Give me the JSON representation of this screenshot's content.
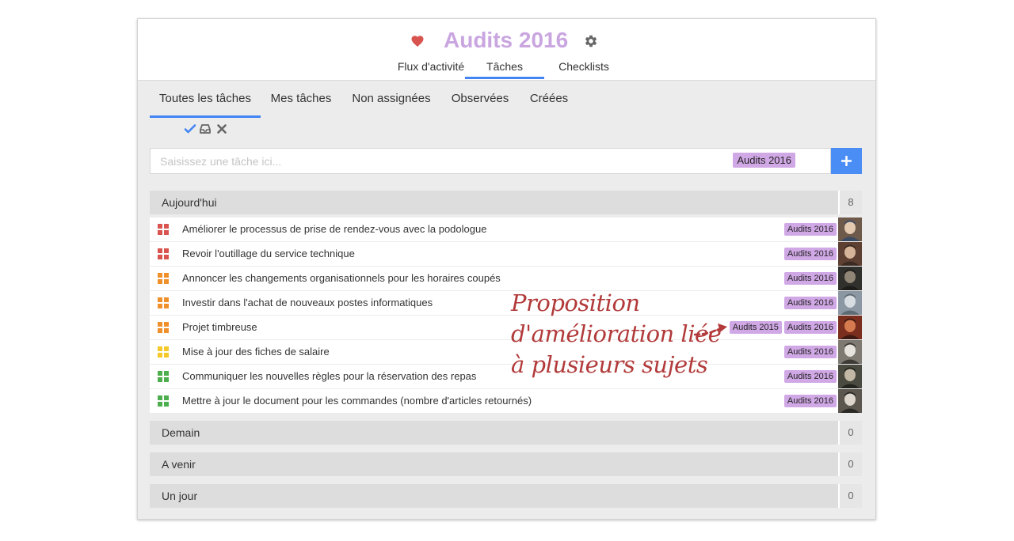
{
  "colors": {
    "title": "#c9a6e0",
    "accent": "#4285f4",
    "tag_bg": "#d1a8e6",
    "priority_red": "#d9534f",
    "priority_orange": "#f0902a",
    "priority_yellow": "#f5c92a",
    "priority_green": "#4cae4c",
    "annotation": "#b23a3a"
  },
  "header": {
    "title": "Audits 2016",
    "icons": [
      "heart-icon",
      "gear-icon"
    ],
    "tabs": [
      {
        "label": "Flux d'activité"
      },
      {
        "label": "Tâches",
        "active": true
      },
      {
        "label": "Checklists"
      }
    ]
  },
  "subtabs": [
    {
      "label": "Toutes les tâches",
      "active": true
    },
    {
      "label": "Mes tâches"
    },
    {
      "label": "Non assignées"
    },
    {
      "label": "Observées"
    },
    {
      "label": "Créées"
    }
  ],
  "actions": [
    "check-icon",
    "inbox-icon",
    "close-icon"
  ],
  "task_input": {
    "placeholder": "Saisissez une tâche ici...",
    "tag": "Audits 2016",
    "add_icon": "plus-icon"
  },
  "sections": {
    "today": {
      "label": "Aujourd'hui",
      "count": "8"
    },
    "tomorrow": {
      "label": "Demain",
      "count": "0"
    },
    "upcoming": {
      "label": "A venir",
      "count": "0"
    },
    "someday": {
      "label": "Un jour",
      "count": "0"
    }
  },
  "tasks": [
    {
      "text": "Améliorer le processus de prise de rendez-vous avec la podologue",
      "priority": "red",
      "tags": [
        "Audits 2016"
      ]
    },
    {
      "text": "Revoir l'outillage du service technique",
      "priority": "red",
      "tags": [
        "Audits 2016"
      ]
    },
    {
      "text": "Annoncer les changements organisationnels pour les horaires coupés",
      "priority": "orange",
      "tags": [
        "Audits 2016"
      ]
    },
    {
      "text": "Investir dans l'achat de nouveaux postes informatiques",
      "priority": "orange",
      "tags": [
        "Audits 2016"
      ]
    },
    {
      "text": "Projet timbreuse",
      "priority": "orange",
      "tags": [
        "Audits 2015",
        "Audits 2016"
      ]
    },
    {
      "text": "Mise à jour des fiches de salaire",
      "priority": "yellow",
      "tags": [
        "Audits 2016"
      ]
    },
    {
      "text": "Communiquer les nouvelles règles pour la réservation des repas",
      "priority": "green",
      "tags": [
        "Audits 2016"
      ]
    },
    {
      "text": "Mettre à jour le document pour les commandes (nombre d'articles retournés)",
      "priority": "green",
      "tags": [
        "Audits 2016"
      ]
    }
  ],
  "annotation": {
    "lines": [
      "Proposition",
      "d'amélioration liée",
      "à plusieurs sujets"
    ]
  }
}
